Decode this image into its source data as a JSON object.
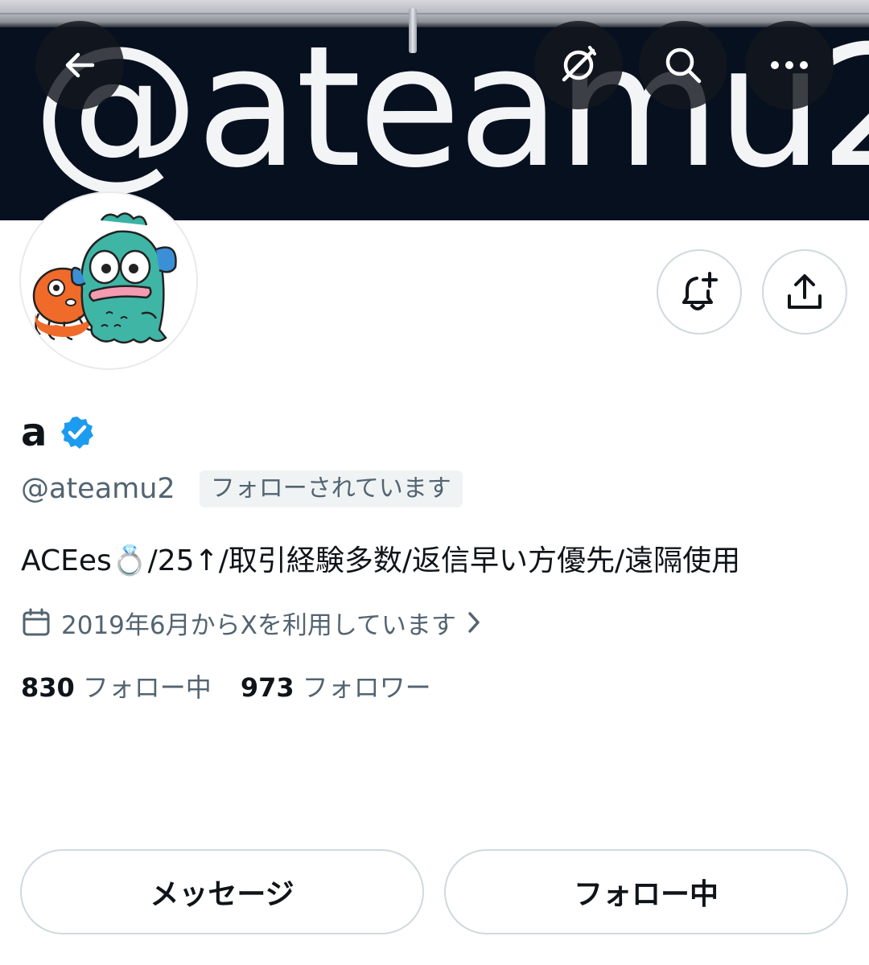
{
  "banner": {
    "text": "@ateamu2"
  },
  "top_bar": {
    "back_icon": "arrow-left-icon",
    "grok_icon": "slashed-circle-icon",
    "search_icon": "search-icon",
    "more_icon": "more-horizontal-icon"
  },
  "profile": {
    "display_name": "a",
    "verified": true,
    "handle": "@ateamu2",
    "follows_you_badge": "フォローされています",
    "bio": "ACEes💍/25↑/取引経験多数/返信早い方優先/遠隔使用",
    "joined": "2019年6月からXを利用しています",
    "following_count": "830",
    "following_label": "フォロー中",
    "followers_count": "973",
    "followers_label": "フォロワー"
  },
  "actions": {
    "notify_icon": "bell-plus-icon",
    "share_icon": "share-icon",
    "message_label": "メッセージ",
    "following_button_label": "フォロー中"
  },
  "colors": {
    "verified": "#1d9bf0",
    "secondary_text": "#536471",
    "primary_text": "#0f1419",
    "border": "#cfd9de",
    "banner_bg": "#07101f"
  }
}
